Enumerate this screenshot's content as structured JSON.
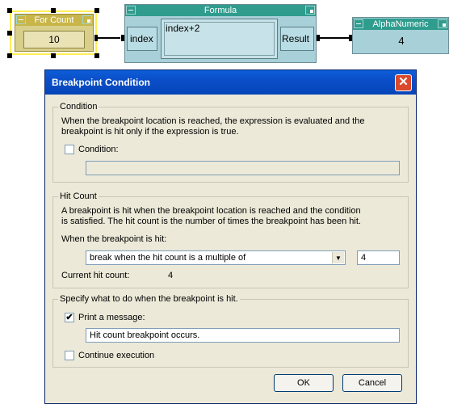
{
  "canvas": {
    "for_count": {
      "title": "For Count",
      "value": "10"
    },
    "formula": {
      "title": "Formula",
      "input_label": "index",
      "expression": "index+2",
      "output_label": "Result"
    },
    "alphanumeric": {
      "title": "AlphaNumeric",
      "value": "4"
    }
  },
  "dialog": {
    "title": "Breakpoint Condition",
    "close_glyph": "✕",
    "condition": {
      "group_label": "Condition",
      "description_line1": "When the breakpoint location is reached, the expression is evaluated and the",
      "description_line2": "breakpoint is hit only if the expression is true.",
      "checkbox_label": "Condition:",
      "checked": false,
      "expression_value": ""
    },
    "hit_count": {
      "group_label": "Hit Count",
      "description_line1": "A breakpoint is hit when the breakpoint location is reached and the condition",
      "description_line2": "is satisfied. The hit count is the number of times the breakpoint has been hit.",
      "when_label": "When the breakpoint is hit:",
      "mode_selected": "break when the hit count is a multiple of",
      "mode_value": "4",
      "current_label": "Current hit count:",
      "current_value": "4"
    },
    "action": {
      "group_label": "Specify what to do when the breakpoint is hit.",
      "print_label": "Print a message:",
      "print_checked": true,
      "check_glyph": "✔",
      "message_value": "Hit count breakpoint occurs.",
      "continue_label": "Continue execution",
      "continue_checked": false
    },
    "ok_label": "OK",
    "cancel_label": "Cancel"
  }
}
